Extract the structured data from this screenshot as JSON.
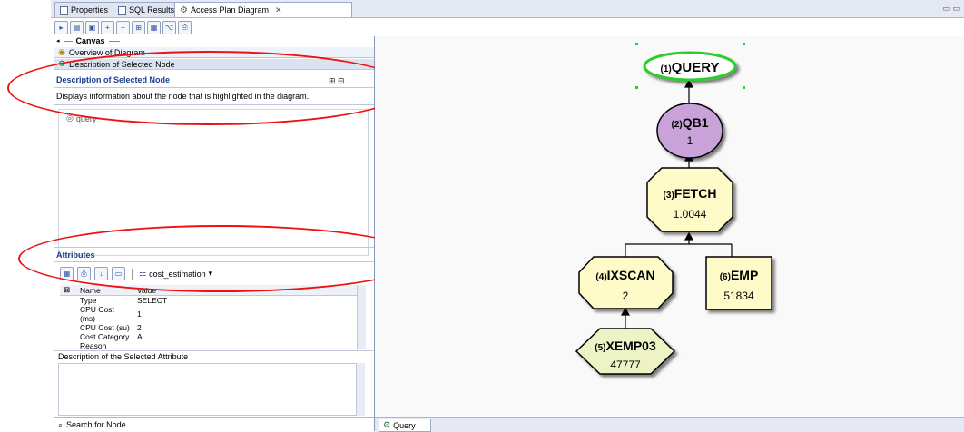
{
  "tabs": [
    {
      "label": "Properties"
    },
    {
      "label": "SQL Results"
    },
    {
      "label": "Access Plan Diagram"
    }
  ],
  "canvas_label": "Canvas",
  "sections": {
    "overview": "Overview of Diagram",
    "description_nav": "Description of Selected Node",
    "description_title": "Description of Selected Node",
    "description_text": "Displays information about the node that is highlighted in the diagram.",
    "tree_item": "query",
    "attributes_title": "Attributes",
    "attr_combo": "cost_estimation",
    "selected_attr_desc": "Description of the Selected Attribute",
    "search": "Search for Node"
  },
  "table": {
    "headers": [
      "Name",
      "Value"
    ],
    "rows": [
      [
        "Type",
        "SELECT"
      ],
      [
        "CPU Cost (ms)",
        "1"
      ],
      [
        "CPU Cost (su)",
        "2"
      ],
      [
        "Cost Category",
        "A"
      ],
      [
        "Reason",
        ""
      ]
    ]
  },
  "nodes": [
    {
      "num": "(1)",
      "name": "QUERY",
      "value": ""
    },
    {
      "num": "(2)",
      "name": "QB1",
      "value": "1"
    },
    {
      "num": "(3)",
      "name": "FETCH",
      "value": "1.0044"
    },
    {
      "num": "(4)",
      "name": "IXSCAN",
      "value": "2"
    },
    {
      "num": "(6)",
      "name": "EMP",
      "value": "51834"
    },
    {
      "num": "(5)",
      "name": "XEMP03",
      "value": "47777"
    }
  ],
  "bottom_tab": "Query",
  "colors": {
    "highlight_ring": "#e11111",
    "query_border": "#2ecc2e",
    "qb_fill": "#c8a2d8",
    "op_fill": "#fffbc8",
    "index_fill": "#edf3c4"
  }
}
